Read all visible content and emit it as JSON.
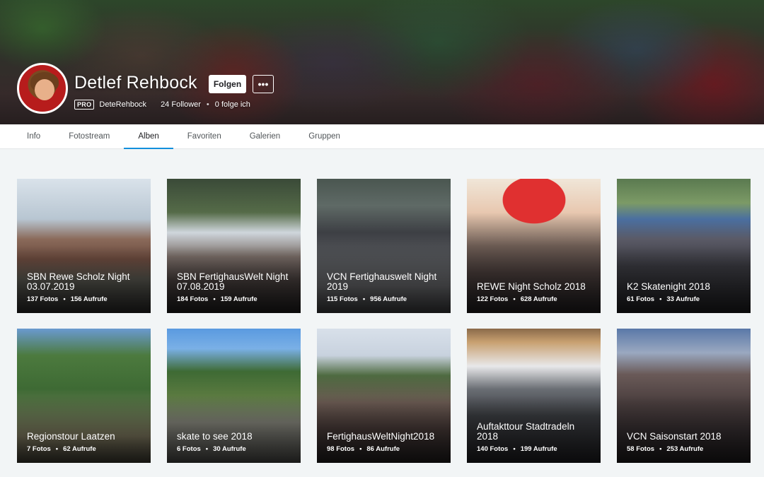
{
  "profile": {
    "name": "Detlef Rehbock",
    "follow_label": "Folgen",
    "more_label": "•••",
    "pro_badge": "PRO",
    "username": "DeteRehbock",
    "followers": "24 Follower",
    "following": "0 folge ich"
  },
  "tabs": [
    {
      "label": "Info"
    },
    {
      "label": "Fotostream"
    },
    {
      "label": "Alben",
      "active": true
    },
    {
      "label": "Favoriten"
    },
    {
      "label": "Galerien"
    },
    {
      "label": "Gruppen"
    }
  ],
  "albums": [
    {
      "title": "SBN Rewe Scholz Night 03.07.2019",
      "photos": "137 Fotos",
      "views": "156 Aufrufe"
    },
    {
      "title": "SBN FertighausWelt Night 07.08.2019",
      "photos": "184 Fotos",
      "views": "159 Aufrufe"
    },
    {
      "title": "VCN Fertighauswelt Night 2019",
      "photos": "115 Fotos",
      "views": "956 Aufrufe"
    },
    {
      "title": "REWE Night Scholz 2018",
      "photos": "122 Fotos",
      "views": "628 Aufrufe"
    },
    {
      "title": "K2 Skatenight 2018",
      "photos": "61 Fotos",
      "views": "33 Aufrufe"
    },
    {
      "title": "Regionstour Laatzen",
      "photos": "7 Fotos",
      "views": "62 Aufrufe"
    },
    {
      "title": "skate to see 2018",
      "photos": "6 Fotos",
      "views": "30 Aufrufe"
    },
    {
      "title": "FertighausWeltNight2018",
      "photos": "98 Fotos",
      "views": "86 Aufrufe"
    },
    {
      "title": "Auftakttour Stadtradeln 2018",
      "photos": "140 Fotos",
      "views": "199 Aufrufe"
    },
    {
      "title": "VCN Saisonstart 2018",
      "photos": "58 Fotos",
      "views": "253 Aufrufe"
    }
  ],
  "colors": {
    "accent": "#128fdc",
    "page_bg": "#f2f5f6"
  }
}
